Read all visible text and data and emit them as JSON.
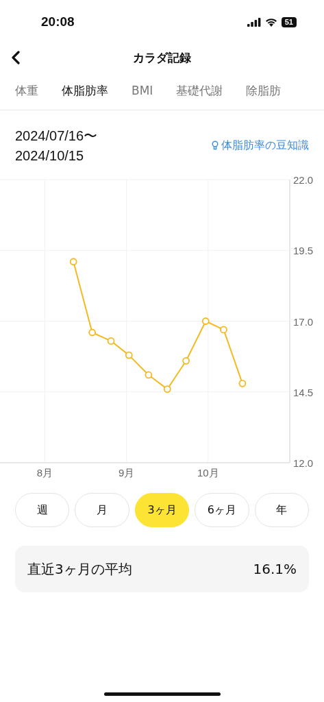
{
  "status_bar": {
    "time": "20:08",
    "battery": "51"
  },
  "nav": {
    "title": "カラダ記録"
  },
  "tabs": [
    {
      "label": "体重",
      "selected": false
    },
    {
      "label": "体脂肪率",
      "selected": true
    },
    {
      "label": "BMI",
      "selected": false
    },
    {
      "label": "基礎代謝",
      "selected": false
    },
    {
      "label": "除脂肪",
      "selected": false
    }
  ],
  "period": {
    "start": "2024/07/16〜",
    "end": "2024/10/15"
  },
  "tip_link": "体脂肪率の豆知識",
  "chart": {
    "chart_data": {
      "type": "line",
      "x": [
        8.35,
        8.58,
        8.81,
        9.03,
        9.27,
        9.5,
        9.73,
        9.97,
        10.19,
        10.42
      ],
      "xlim": [
        7.45,
        11.0
      ],
      "ylim": [
        12,
        22
      ],
      "yticks": [
        {
          "value": 12,
          "label": "12.0"
        },
        14.5,
        {
          "value": 17,
          "label": "17.0"
        },
        19.5,
        {
          "value": 22,
          "label": "22.0"
        }
      ],
      "xticks": [
        {
          "value": 8,
          "label": "8月"
        },
        {
          "value": 9,
          "label": "9月"
        },
        {
          "value": 10,
          "label": "10月"
        }
      ],
      "grid": true,
      "series": [
        {
          "marker": "circle",
          "color": "#f5b921",
          "values": [
            19.1,
            16.6,
            16.3,
            15.8,
            15.1,
            14.6,
            15.6,
            17.0,
            16.7,
            14.8
          ]
        }
      ]
    }
  },
  "ranges": [
    {
      "label": "週",
      "selected": false
    },
    {
      "label": "月",
      "selected": false
    },
    {
      "label": "3ヶ月",
      "selected": true
    },
    {
      "label": "6ヶ月",
      "selected": false
    },
    {
      "label": "年",
      "selected": false
    }
  ],
  "average": {
    "label": "直近3ヶ月の平均",
    "value": "16.1%"
  }
}
